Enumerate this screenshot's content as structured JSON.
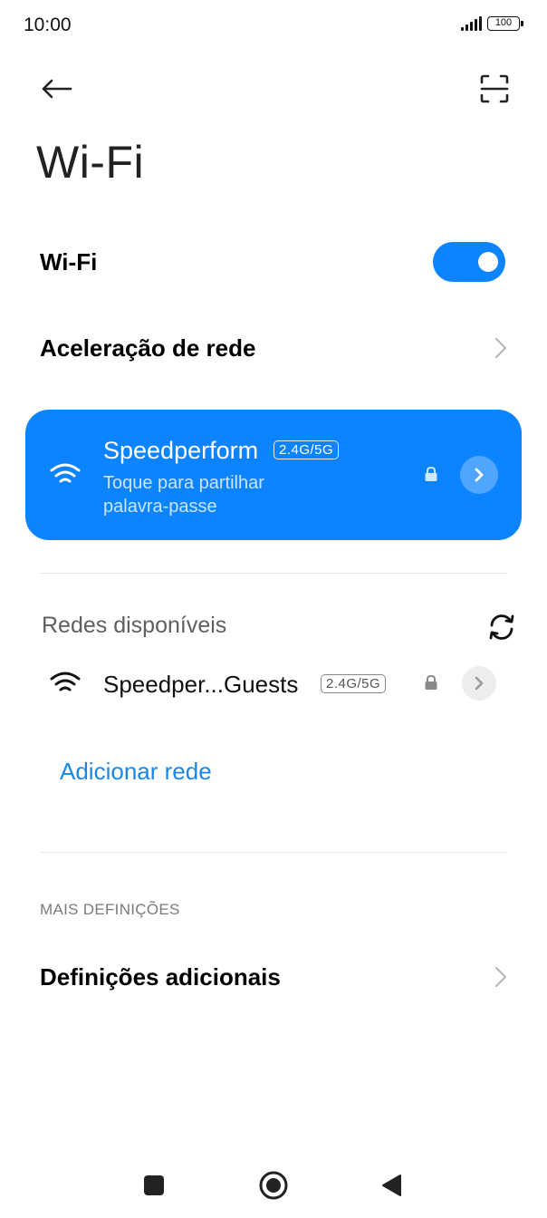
{
  "status_bar": {
    "time": "10:00",
    "battery": "100"
  },
  "header": {
    "back_icon": "arrow-left-icon",
    "scan_icon": "qr-scan-icon",
    "title": "Wi-Fi"
  },
  "wifi_toggle": {
    "label": "Wi-Fi",
    "enabled": true
  },
  "network_acceleration": {
    "label": "Aceleração de rede"
  },
  "connected_network": {
    "ssid": "Speedperform",
    "band": "2.4G/5G",
    "subtitle": "Toque para partilhar palavra-passe",
    "secured": true
  },
  "available_networks": {
    "header": "Redes disponíveis",
    "refresh_icon": "refresh-icon",
    "items": [
      {
        "ssid": "Speedper...Guests",
        "band": "2.4G/5G",
        "secured": true
      }
    ]
  },
  "add_network": {
    "label": "Adicionar rede"
  },
  "more_settings": {
    "caption": "MAIS DEFINIÇÕES",
    "additional_label": "Definições adicionais"
  },
  "nav_bar": {
    "recents_icon": "square-recents-icon",
    "home_icon": "circle-home-icon",
    "back_icon": "triangle-back-icon"
  },
  "colors": {
    "accent": "#0d84ff",
    "link": "#1a86e8"
  }
}
